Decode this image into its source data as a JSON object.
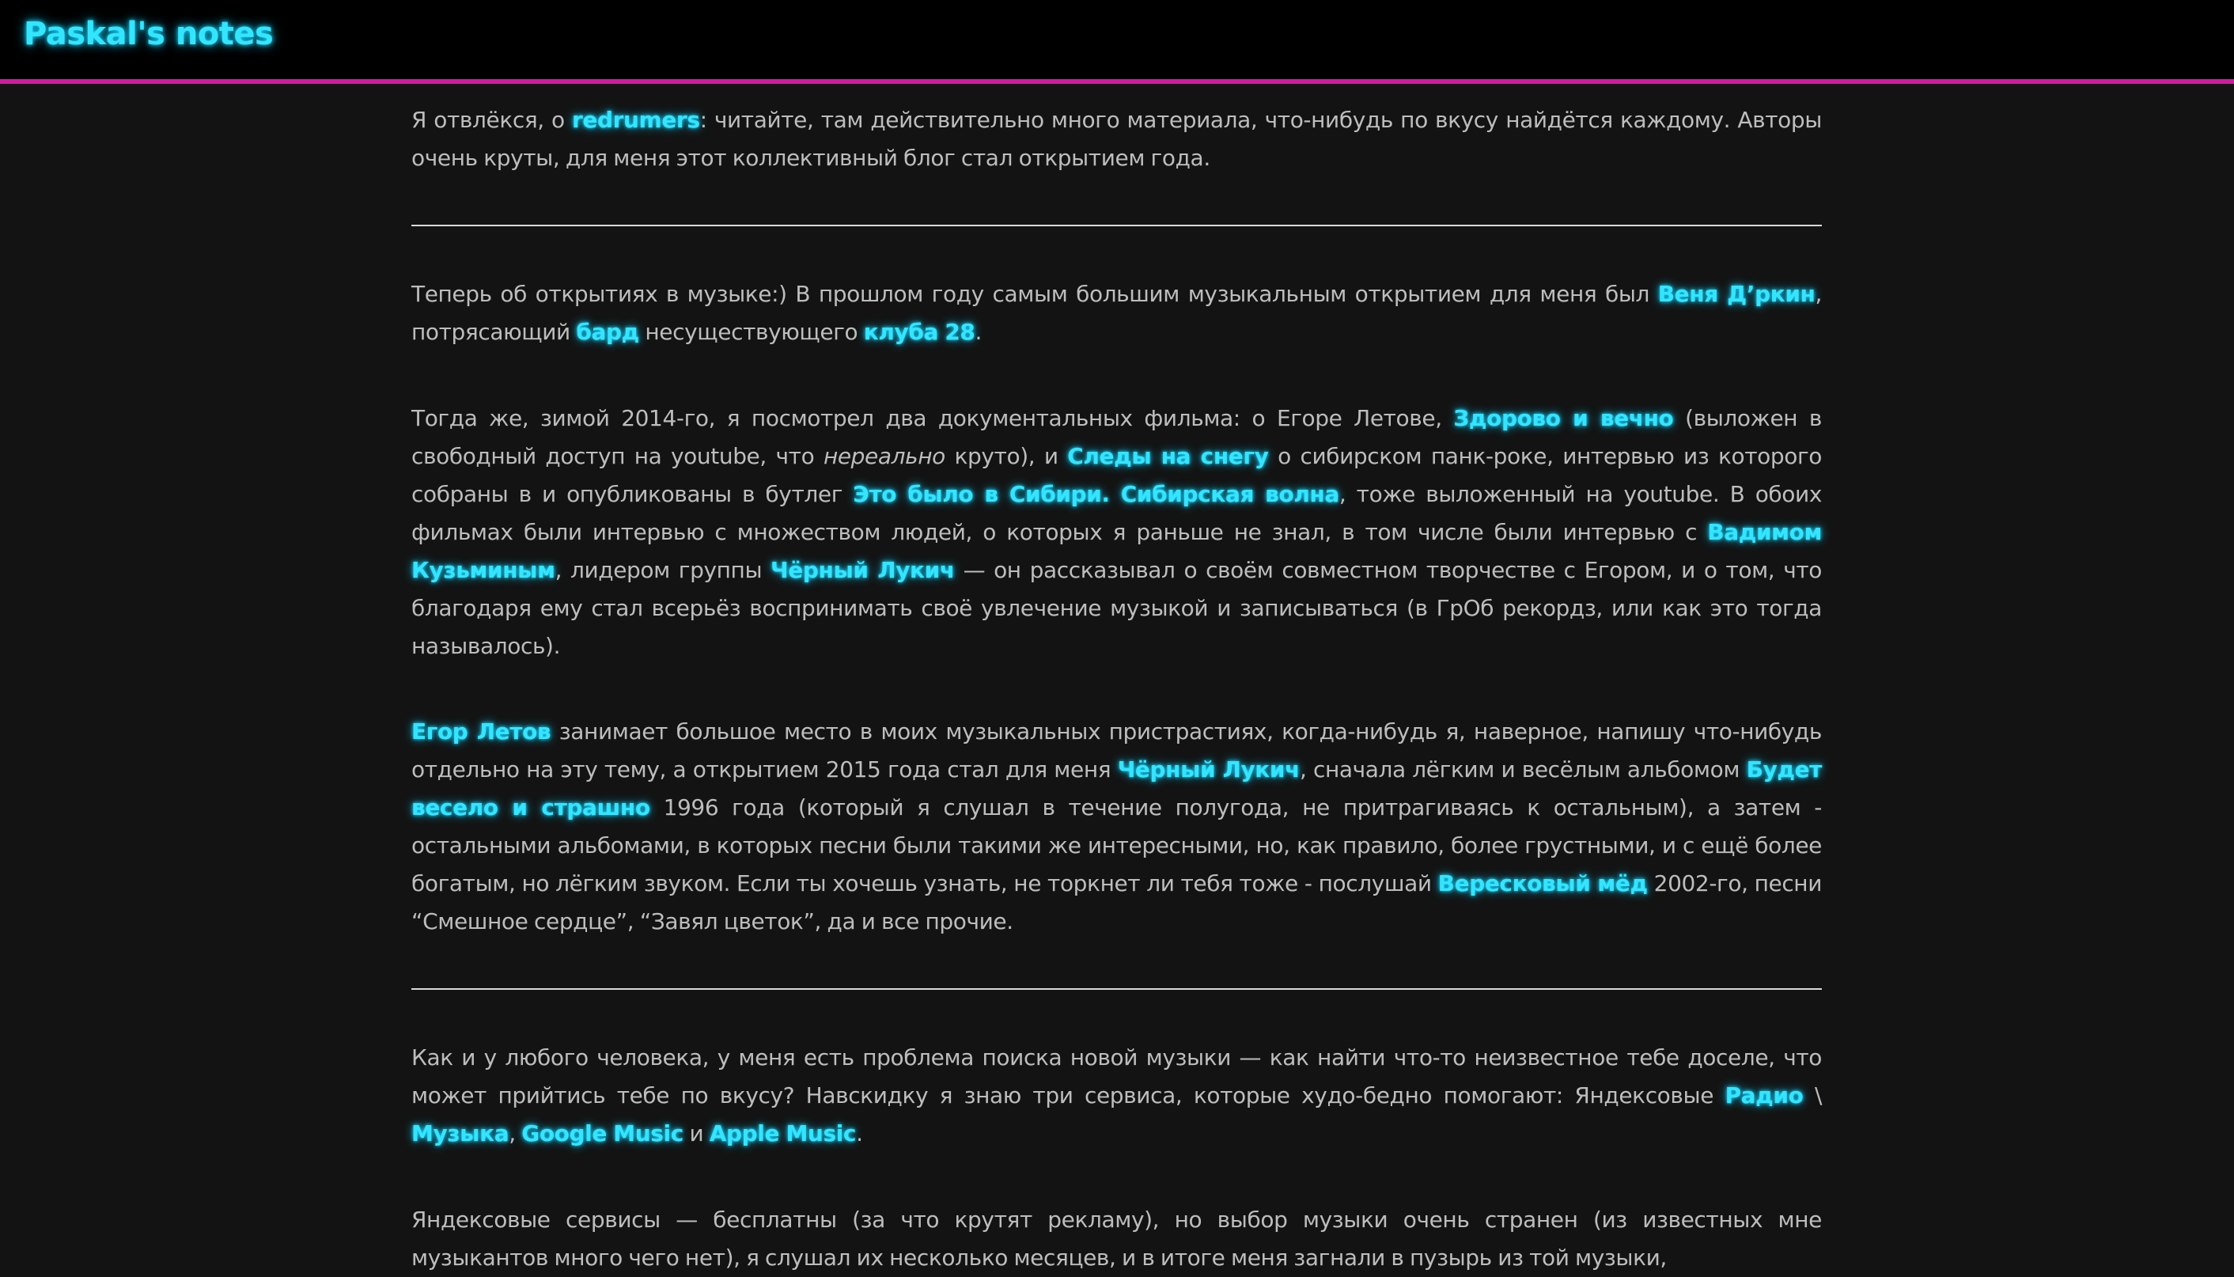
{
  "header": {
    "title": "Paskal's notes"
  },
  "p1": {
    "t1": "Я отвлёкся, о ",
    "l1": "redrumers",
    "t2": ": читайте, там действительно много материала, что-нибудь по вкусу найдётся каждому. Авторы очень круты, для меня этот коллективный блог стал открытием года."
  },
  "p2": {
    "t1": "Теперь об открытиях в музыке:) В прошлом году самым большим музыкальным открытием для меня был ",
    "l1": "Веня Д’ркин",
    "t2": ", потрясающий ",
    "l2": "бард",
    "t3": " несуществующего ",
    "l3": "клуба 28",
    "t4": "."
  },
  "p3": {
    "t1": "Тогда же, зимой 2014-го, я посмотрел два документальных фильма: о Егоре Летове, ",
    "l1": "Здорово и вечно",
    "t2": " (выложен в свободный доступ на youtube, что ",
    "em1": "нереально",
    "t3": " круто), и ",
    "l2": "Следы на снегу",
    "t4": " о сибирском панк-роке, интервью из которого собраны в и опубликованы в бутлег ",
    "l3": "Это было в Сибири. Сибирская волна",
    "t5": ", тоже выложенный на youtube. В обоих фильмах были интервью с множеством людей, о которых я раньше не знал, в том числе были интервью с ",
    "l4": "Вадимом Кузьминым",
    "t6": ", лидером группы ",
    "l5": "Чёрный Лукич",
    "t7": " — он рассказывал о своём совместном творчестве с Егором, и о том, что благодаря ему стал всерьёз воспринимать своё увлечение музыкой и записываться (в ГрОб рекордз, или как это тогда называлось)."
  },
  "p4": {
    "l1": "Егор Летов",
    "t1": " занимает большое место в моих музыкальных пристрастиях, когда-нибудь я, наверное, напишу что-нибудь отдельно на эту тему, а открытием 2015 года стал для меня ",
    "l2": "Чёрный Лукич",
    "t2": ", сначала лёгким и весёлым альбомом ",
    "l3": "Будет весело и страшно",
    "t3": " 1996 года (который я слушал в течение полугода, не притрагиваясь к остальным), а затем - остальными альбомами, в которых песни были такими же интересными, но, как правило, более грустными, и с ещё более богатым, но лёгким звуком. Если ты хочешь узнать, не торкнет ли тебя тоже - послушай ",
    "l4": "Вересковый мёд",
    "t4": " 2002-го, песни “Смешное сердце”, “Завял цветок”, да и все прочие."
  },
  "p5": {
    "t1": "Как и у любого человека, у меня есть проблема поиска новой музыки — как найти что-то неизвестное тебе доселе, что может прийтись тебе по вкусу? Навскидку я знаю три сервиса, которые худо-бедно помогают: Яндексовые ",
    "l1": "Радио",
    "t2": " \\ ",
    "l2": "Музыка",
    "t3": ", ",
    "l3": "Google Music",
    "t4": " и ",
    "l4": "Apple Music",
    "t5": "."
  },
  "p6": {
    "t1": "Яндексовые сервисы — бесплатны (за что крутят рекламу), но выбор музыки очень странен (из известных мне музыкантов много чего нет), я слушал их несколько месяцев, и в итоге меня загнали в пузырь из той музыки,"
  }
}
